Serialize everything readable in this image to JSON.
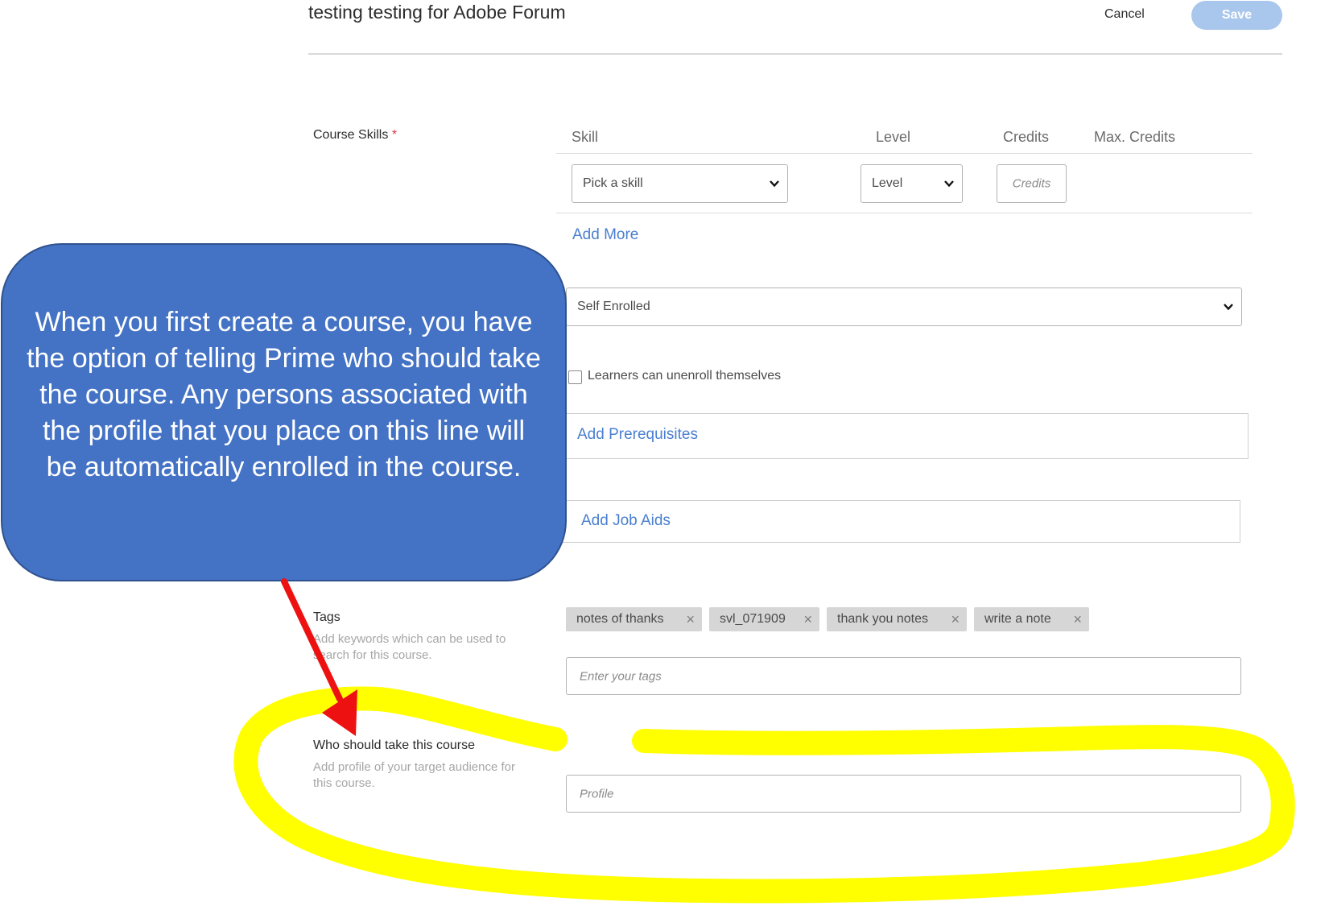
{
  "header": {
    "title": "testing testing for Adobe Forum",
    "cancel_label": "Cancel",
    "save_label": "Save"
  },
  "skills": {
    "label": "Course Skills",
    "required_mark": "*",
    "columns": [
      "Skill",
      "Level",
      "Credits",
      "Max. Credits"
    ],
    "skill_select_value": "Pick a skill",
    "level_select_value": "Level",
    "credits_placeholder": "Credits",
    "add_more_label": "Add More"
  },
  "enrollment": {
    "select_value": "Self Enrolled",
    "unenroll_checkbox_label": "Learners can unenroll themselves",
    "unenroll_checked": false
  },
  "prerequisites": {
    "add_label": "Add Prerequisites"
  },
  "job_aids": {
    "add_label": "Add Job Aids"
  },
  "tags": {
    "label": "Tags",
    "description": "Add keywords which can be used to search for this course.",
    "items": [
      "notes of thanks",
      "svl_071909",
      "thank you notes",
      "write a note"
    ],
    "remove_icon": "×",
    "input_placeholder": "Enter your tags"
  },
  "audience": {
    "label": "Who should take this course",
    "description": "Add profile of your target audience for this course.",
    "input_placeholder": "Profile"
  },
  "annotation": {
    "callout_text": "When you first create a course, you have the option of telling Prime who should take the course. Any persons associated with the profile that you place on this line will be automatically enrolled in the course.",
    "callout_color": "#4472c4",
    "arrow_color": "#ee1111",
    "highlight_color": "#ffff00"
  }
}
